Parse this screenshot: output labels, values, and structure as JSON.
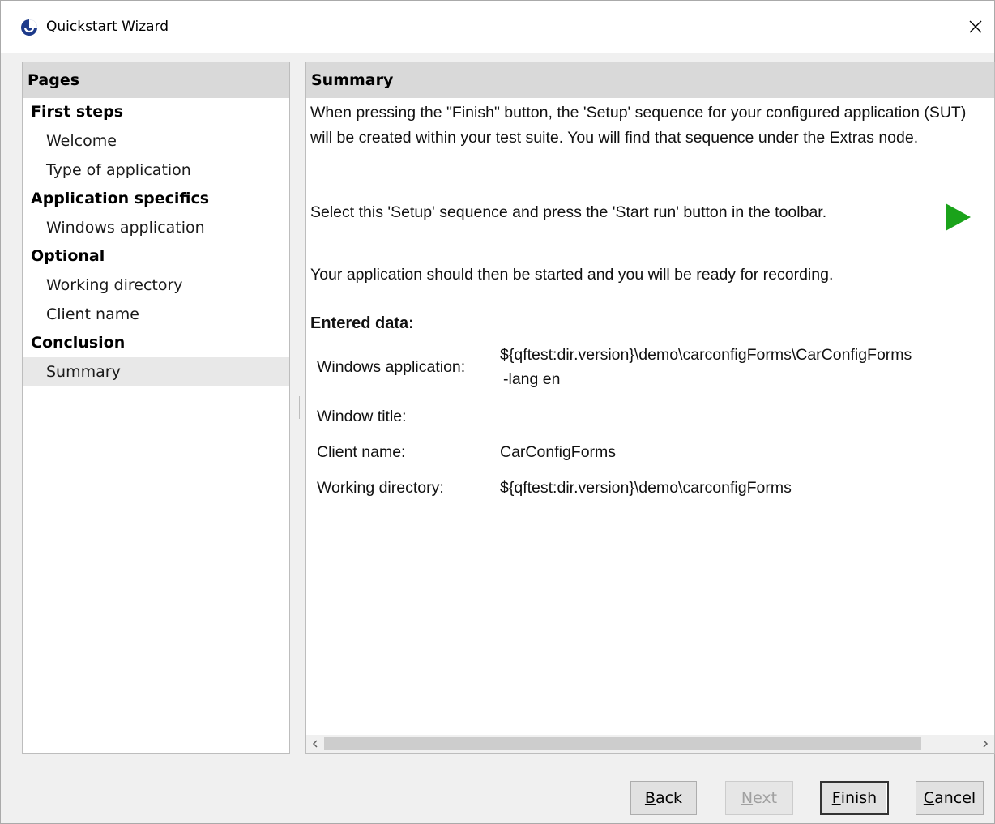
{
  "window": {
    "title": "Quickstart Wizard",
    "close_label": "✕"
  },
  "pages_panel": {
    "header": "Pages",
    "groups": [
      {
        "label": "First steps",
        "items": [
          "Welcome",
          "Type of application"
        ]
      },
      {
        "label": "Application specifics",
        "items": [
          "Windows application"
        ]
      },
      {
        "label": "Optional",
        "items": [
          "Working directory",
          "Client name"
        ]
      },
      {
        "label": "Conclusion",
        "items": [
          "Summary"
        ]
      }
    ],
    "selected_item": "Summary"
  },
  "summary": {
    "header": "Summary",
    "paragraph1": "When pressing the \"Finish\" button, the 'Setup' sequence for your configured application (SUT) will be created within your test suite. You will find that sequence under the Extras node.",
    "paragraph2": "Select this 'Setup' sequence and press the 'Start run' button in the toolbar.",
    "play_icon": "play-icon",
    "paragraph3": "Your application should then be started and you will be ready for recording.",
    "entered_data_title": "Entered data:",
    "rows": {
      "windows_application": {
        "label": "Windows application:",
        "value_line1": "${qftest:dir.version}\\demo\\carconfigForms\\CarConfigForms",
        "value_line2": "-lang en"
      },
      "window_title": {
        "label": "Window title:",
        "value": ""
      },
      "client_name": {
        "label": "Client name:",
        "value": "CarConfigForms"
      },
      "working_directory": {
        "label": "Working directory:",
        "value": "${qftest:dir.version}\\demo\\carconfigForms"
      }
    }
  },
  "buttons": {
    "back": {
      "mnemonic": "B",
      "rest": "ack"
    },
    "next": {
      "mnemonic": "N",
      "rest": "ext"
    },
    "finish": {
      "mnemonic": "F",
      "rest": "inish"
    },
    "cancel": {
      "mnemonic": "C",
      "rest": "ancel"
    }
  },
  "colors": {
    "play_green": "#1aa31a",
    "header_gray": "#d9d9d9",
    "selected_bg": "#e8e8e8"
  }
}
